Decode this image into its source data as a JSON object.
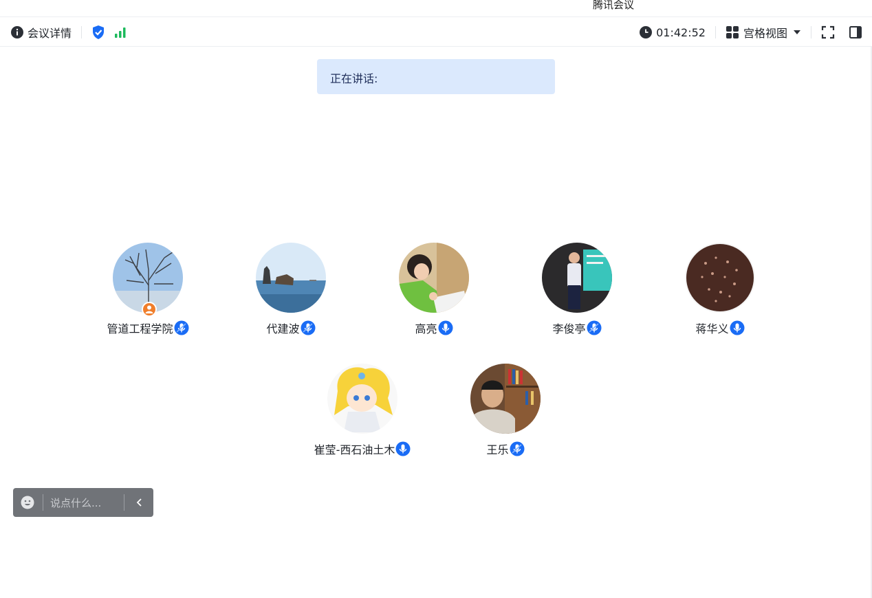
{
  "window": {
    "title": "腾讯会议"
  },
  "toolbar": {
    "meeting_details_label": "会议详情",
    "info_icon": "info-circle-icon",
    "security_icon": "shield-check-icon",
    "network_icon": "signal-bars-icon",
    "timer": "01:42:52",
    "view_label": "宫格视图",
    "colors": {
      "shield": "#1a6cf5",
      "signal": "#1cba5c"
    }
  },
  "speaking": {
    "label": "正在讲话:"
  },
  "participants": [
    {
      "name": "管道工程学院",
      "host": true,
      "mic": "active"
    },
    {
      "name": "代建波",
      "mic": "active"
    },
    {
      "name": "高亮",
      "mic": "on"
    },
    {
      "name": "李俊亭",
      "mic": "active"
    },
    {
      "name": "蒋华义",
      "mic": "on"
    },
    {
      "name": "崔莹-西石油土木",
      "mic": "on"
    },
    {
      "name": "王乐",
      "mic": "active"
    }
  ],
  "chat": {
    "placeholder": "说点什么..."
  },
  "colors": {
    "accent": "#1a6cf5",
    "speaking_bg": "#dbe9fd",
    "host_badge": "#f07e2b",
    "chat_bg": "#707378"
  }
}
